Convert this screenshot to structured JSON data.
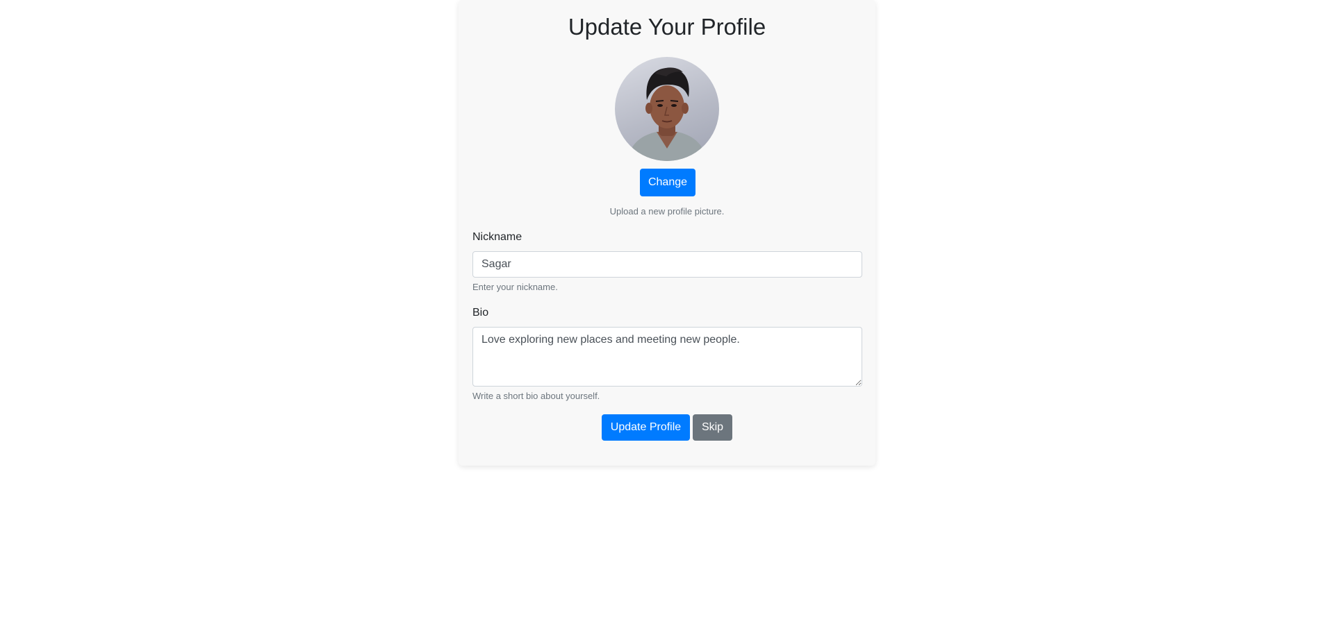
{
  "page": {
    "title": "Update Your Profile"
  },
  "avatar": {
    "icon": "profile-photo",
    "change_label": "Change",
    "help_text": "Upload a new profile picture."
  },
  "nickname": {
    "label": "Nickname",
    "value": "Sagar",
    "help_text": "Enter your nickname."
  },
  "bio": {
    "label": "Bio",
    "value": "Love exploring new places and meeting new people.",
    "help_text": "Write a short bio about yourself."
  },
  "actions": {
    "update_label": "Update Profile",
    "skip_label": "Skip"
  },
  "colors": {
    "primary": "#007bff",
    "secondary": "#6c757d",
    "card_bg": "#f8f8f8"
  }
}
